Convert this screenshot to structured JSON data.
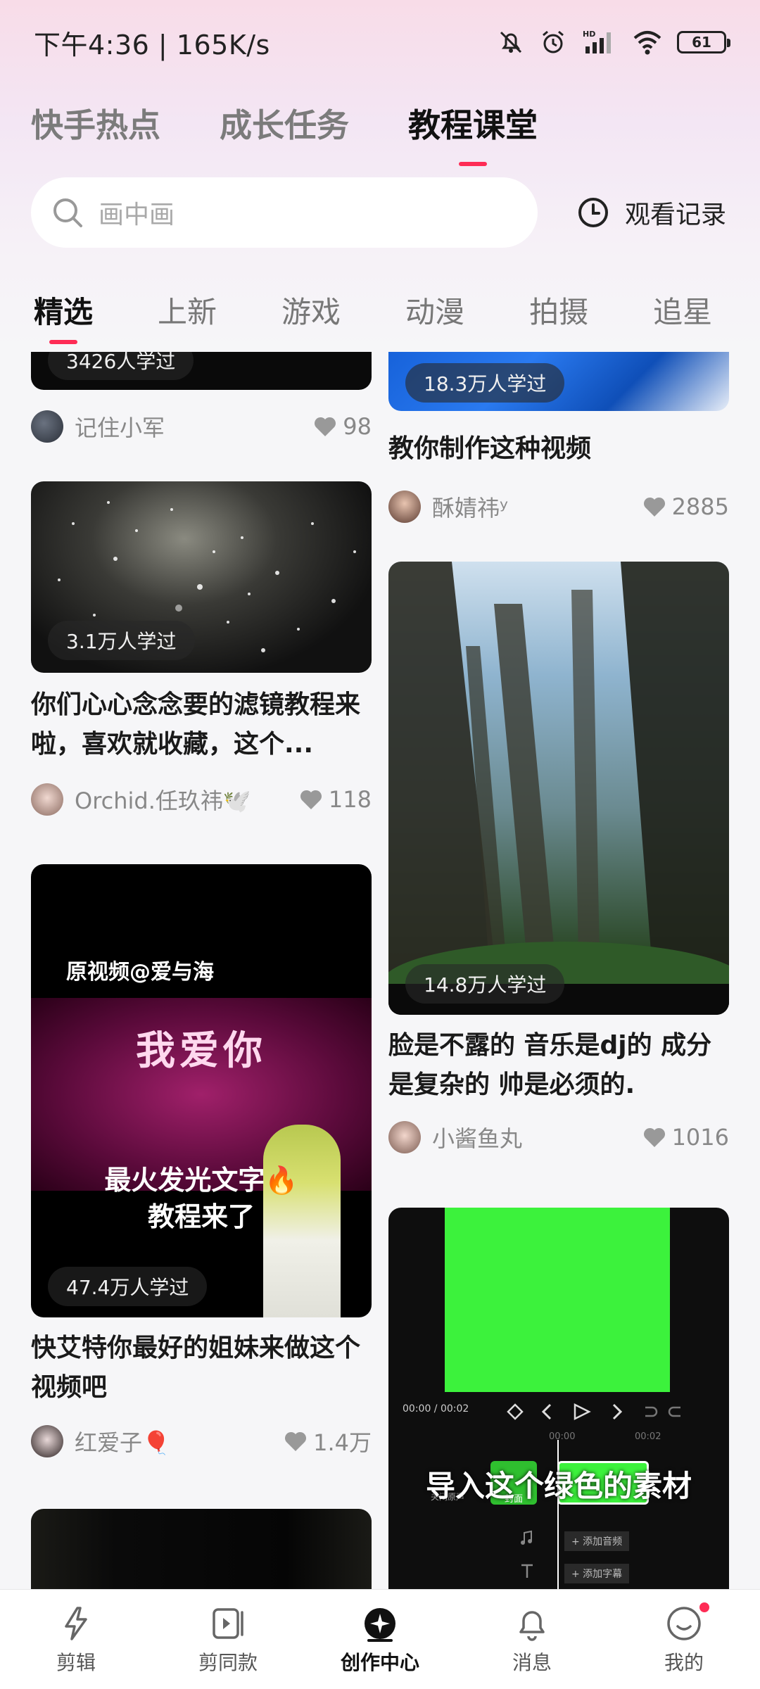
{
  "status_bar": {
    "time": "下午4:36 | 165K/s",
    "battery": "61"
  },
  "main_tabs": [
    {
      "label": "快手热点"
    },
    {
      "label": "成长任务"
    },
    {
      "label": "教程课堂"
    }
  ],
  "search": {
    "placeholder": "画中画",
    "history_label": "观看记录"
  },
  "sub_tabs": [
    {
      "label": "精选"
    },
    {
      "label": "上新"
    },
    {
      "label": "游戏"
    },
    {
      "label": "动漫"
    },
    {
      "label": "拍摄"
    },
    {
      "label": "追星"
    }
  ],
  "cards": [
    {
      "learned": "3426人学过",
      "title": "",
      "author": "记住小军",
      "likes": "98"
    },
    {
      "learned": "18.3万人学过",
      "title": "教你制作这种视频",
      "author": "酥婧祎ʸ",
      "likes": "2885"
    },
    {
      "learned": "3.1万人学过",
      "title": "你们心心念念要的滤镜教程来啦，喜欢就收藏，这个...",
      "author": "Orchid.任玖祎🕊️",
      "likes": "118"
    },
    {
      "learned": "14.8万人学过",
      "title": "脸是不露的 音乐是dj的 成分是复杂的 帅是必须的.",
      "author": "小酱鱼丸",
      "likes": "1016"
    },
    {
      "learned": "47.4万人学过",
      "title": "快艾特你最好的姐妹来做这个视频吧",
      "author": "红爱子🎈",
      "likes": "1.4万",
      "overlay": {
        "header": "原视频@爱与海",
        "big": "我爱你",
        "caption1": "最火发光文字🔥",
        "caption2": "教程来了"
      }
    },
    {
      "learned": "",
      "title": "",
      "author": "",
      "likes": "",
      "overlay": {
        "time": "00:00 / 00:02",
        "cover": "封面",
        "mute": "关闭原声",
        "caption": "导入这个绿色的素材",
        "add_audio": "+ 添加音频",
        "add_caption": "+ 添加字幕",
        "t1": "00:00",
        "t2": "00:02"
      }
    }
  ],
  "bottom_nav": [
    {
      "label": "剪辑"
    },
    {
      "label": "剪同款"
    },
    {
      "label": "创作中心"
    },
    {
      "label": "消息"
    },
    {
      "label": "我的"
    }
  ],
  "colors": {
    "accent": "#fe2c55",
    "green_screen": "#3cf23c"
  }
}
